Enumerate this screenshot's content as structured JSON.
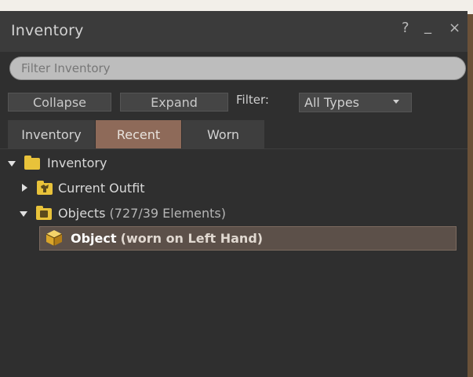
{
  "window": {
    "title": "Inventory",
    "help_icon": "question-icon",
    "minimize_icon": "minimize-icon",
    "close_icon": "close-icon",
    "help_glyph": "?",
    "minimize_glyph": "_",
    "close_glyph": "×"
  },
  "filter": {
    "placeholder": "Filter Inventory",
    "value": ""
  },
  "toolbar": {
    "collapse_label": "Collapse",
    "expand_label": "Expand",
    "filter_label": "Filter:",
    "filter_selected": "All Types"
  },
  "tabs": [
    {
      "label": "Inventory",
      "active": false
    },
    {
      "label": "Recent",
      "active": true
    },
    {
      "label": "Worn",
      "active": false
    }
  ],
  "tree": {
    "root": {
      "label": "Inventory",
      "expanded": true,
      "icon": "folder-icon"
    },
    "items": [
      {
        "label": "Current Outfit",
        "expanded": false,
        "icon": "outfit-folder-icon"
      },
      {
        "label": "Objects",
        "count": "(727/39 Elements)",
        "expanded": true,
        "icon": "objects-folder-icon"
      },
      {
        "label": "Object",
        "suffix": "(worn on Left Hand)",
        "selected": true,
        "icon": "object-cube-icon"
      }
    ]
  },
  "colors": {
    "active_tab": "#8e6a59",
    "folder": "#e8c23a",
    "selection": "#5c5049"
  }
}
